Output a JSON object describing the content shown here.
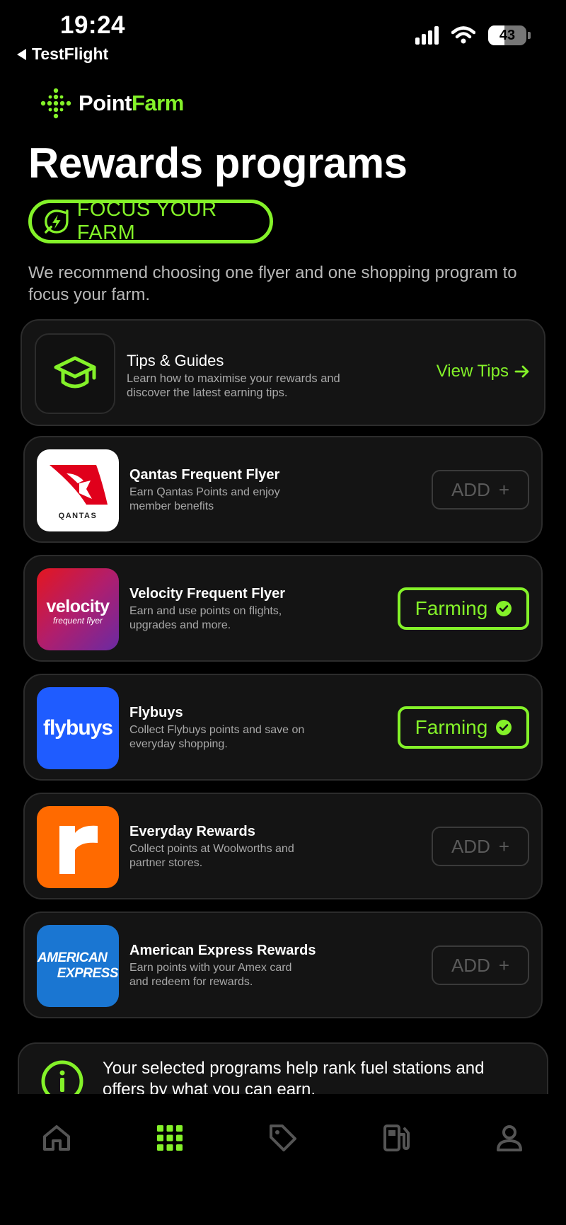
{
  "status_bar": {
    "time": "19:24",
    "back_label": "TestFlight",
    "battery_level": "43",
    "icons": [
      "signal-icon",
      "wifi-icon",
      "battery-icon"
    ]
  },
  "brand": {
    "logo_word_1": "Point",
    "logo_word_2": "Farm",
    "accent_color": "#84f229"
  },
  "header": {
    "title": "Rewards programs",
    "badge_label": "FOCUS YOUR FARM",
    "intro": "We recommend choosing one flyer and one shopping program to focus your farm."
  },
  "tips": {
    "title": "Tips & Guides",
    "description": "Learn how to maximise your rewards and discover the latest earning tips.",
    "action_label": "View Tips"
  },
  "programs": [
    {
      "name": "Qantas Frequent Flyer",
      "description": "Earn Qantas Points and enjoy member benefits",
      "status": "add",
      "action_label": "ADD",
      "logo_text": "QANTAS"
    },
    {
      "name": "Velocity Frequent Flyer",
      "description": "Earn and use points on flights, upgrades and more.",
      "status": "farming",
      "action_label": "Farming",
      "logo_text": "velocity",
      "logo_subtext": "frequent flyer"
    },
    {
      "name": "Flybuys",
      "description": "Collect Flybuys points and save on everyday shopping.",
      "status": "farming",
      "action_label": "Farming",
      "logo_text": "flybuys"
    },
    {
      "name": "Everyday Rewards",
      "description": "Collect points at Woolworths and partner stores.",
      "status": "add",
      "action_label": "ADD",
      "logo_text": "r"
    },
    {
      "name": "American Express Rewards",
      "description": "Earn points with your Amex card and redeem for rewards.",
      "status": "add",
      "action_label": "ADD",
      "logo_text": "AMERICAN",
      "logo_subtext": "EXPRESS"
    }
  ],
  "info": {
    "text": "Your selected programs help rank fuel stations and offers by what you can earn."
  },
  "nav": {
    "items": [
      "home-icon",
      "grid-icon",
      "tag-icon",
      "fuel-icon",
      "profile-icon"
    ],
    "active": "grid-icon"
  }
}
